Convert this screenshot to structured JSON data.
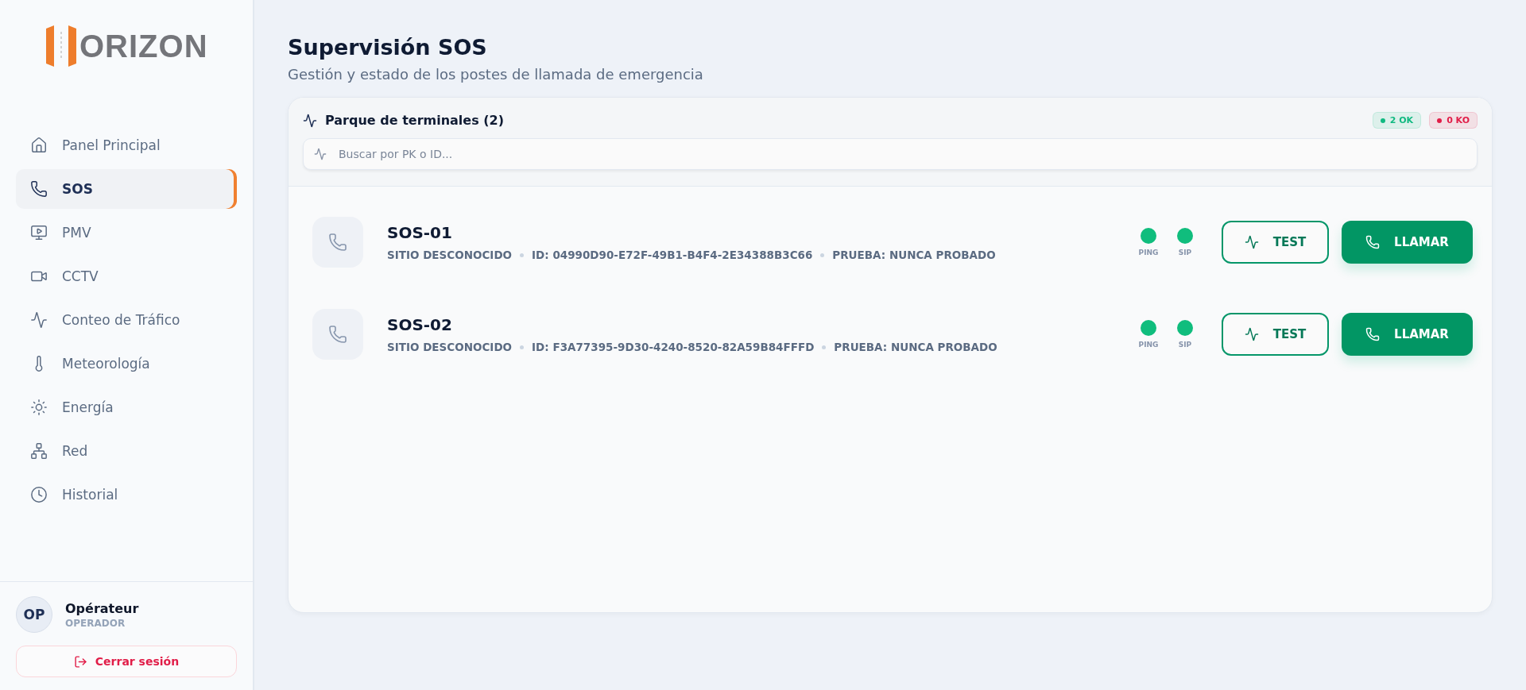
{
  "logo": {
    "text": "ORIZON"
  },
  "nav": [
    {
      "label": "Panel Principal",
      "selected": false
    },
    {
      "label": "SOS",
      "selected": true
    },
    {
      "label": "PMV",
      "selected": false
    },
    {
      "label": "CCTV",
      "selected": false
    },
    {
      "label": "Conteo de Tráfico",
      "selected": false
    },
    {
      "label": "Meteorología",
      "selected": false
    },
    {
      "label": "Energía",
      "selected": false
    },
    {
      "label": "Red",
      "selected": false
    },
    {
      "label": "Historial",
      "selected": false
    }
  ],
  "user": {
    "initials": "OP",
    "name": "Opérateur",
    "role": "OPERADOR"
  },
  "logout": "Cerrar sesión",
  "page": {
    "title": "Supervisión SOS",
    "subtitle": "Gestión y estado de los postes de llamada de emergencia"
  },
  "panel": {
    "title": "Parque de terminales (2)",
    "badges": [
      {
        "label": "2 OK",
        "color": "#10b981"
      },
      {
        "label": "0 KO",
        "color": "#e11d48"
      }
    ],
    "search": {
      "placeholder": "Buscar por PK o ID..."
    }
  },
  "terminals": [
    {
      "name": "SOS-01",
      "site": "SITIO DESCONOCIDO",
      "id": "ID: 04990D90-E72F-49B1-B4F4-2E34388B3C66",
      "test": "PRUEBA: NUNCA PROBADO",
      "indicators": [
        {
          "label": "PING",
          "ok": true
        },
        {
          "label": "SIP",
          "ok": true
        }
      ],
      "test_button": "TEST",
      "call_button": "LLAMAR"
    },
    {
      "name": "SOS-02",
      "site": "SITIO DESCONOCIDO",
      "id": "ID: F3A77395-9D30-4240-8520-82A59B84FFFD",
      "test": "PRUEBA: NUNCA PROBADO",
      "indicators": [
        {
          "label": "PING",
          "ok": true
        },
        {
          "label": "SIP",
          "ok": true
        }
      ],
      "test_button": "TEST",
      "call_button": "LLAMAR"
    }
  ]
}
